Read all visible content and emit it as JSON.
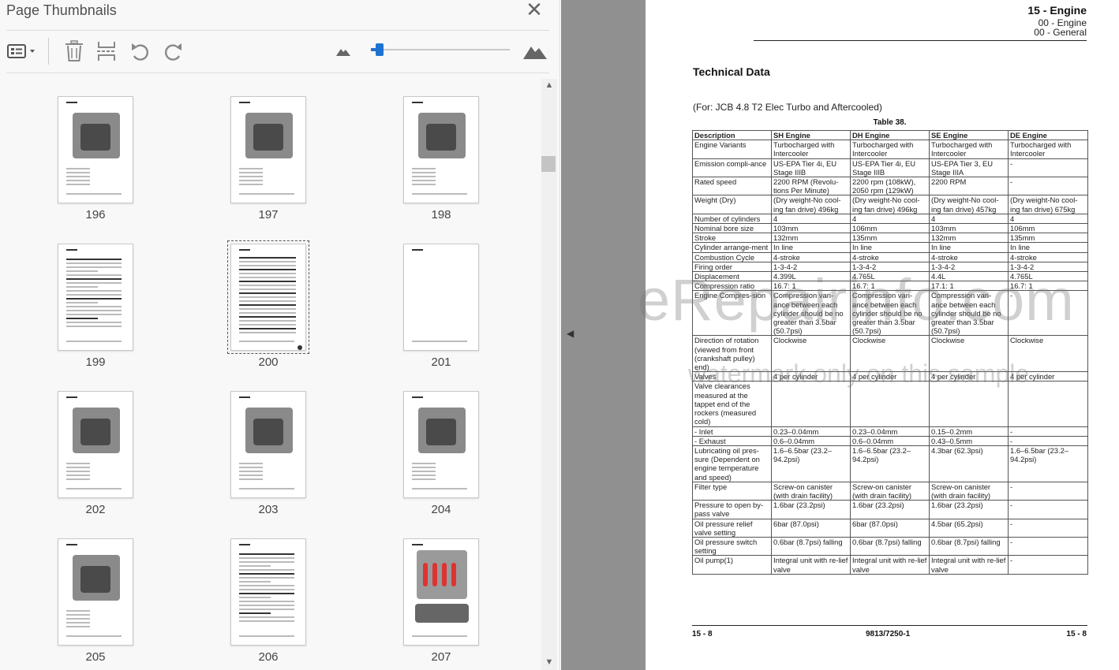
{
  "panel": {
    "title": "Page Thumbnails",
    "close_glyph": "✕",
    "toolbar": [
      {
        "name": "thumbnail-options-icon",
        "glyph": "☰ ▾"
      },
      {
        "name": "delete-pages-icon",
        "glyph": "🗑"
      },
      {
        "name": "extract-pages-icon",
        "glyph": "⎘"
      },
      {
        "name": "rotate-counterclockwise-icon",
        "glyph": "↺"
      },
      {
        "name": "rotate-clockwise-icon",
        "glyph": "↻"
      },
      {
        "name": "zoom-out-mountain-icon",
        "glyph": "▲"
      },
      {
        "name": "zoom-in-mountain-icon",
        "glyph": "▲"
      }
    ],
    "zoom_slider_fraction": 0.04,
    "scroll_up": "▲",
    "scroll_down": "▼",
    "thumbnails": [
      {
        "page": "196",
        "kind": "engine"
      },
      {
        "page": "197",
        "kind": "engine"
      },
      {
        "page": "198",
        "kind": "engine"
      },
      {
        "page": "199",
        "kind": "text"
      },
      {
        "page": "200",
        "kind": "table",
        "selected": true
      },
      {
        "page": "201",
        "kind": "blank"
      },
      {
        "page": "202",
        "kind": "engine"
      },
      {
        "page": "203",
        "kind": "engine"
      },
      {
        "page": "204",
        "kind": "engine"
      },
      {
        "page": "205",
        "kind": "engine"
      },
      {
        "page": "206",
        "kind": "text"
      },
      {
        "page": "207",
        "kind": "injectors"
      }
    ]
  },
  "divider": {
    "collapse_glyph": "◀"
  },
  "document": {
    "header_main": "15 - Engine",
    "header_sub1": "00 - Engine",
    "header_sub2": "00 - General",
    "title": "Technical Data",
    "subtitle": "(For: JCB 4.8 T2 Elec Turbo and Aftercooled)",
    "table_caption": "Table 38.",
    "table": {
      "headers": [
        "Description",
        "SH Engine",
        "DH Engine",
        "SE Engine",
        "DE Engine"
      ],
      "rows": [
        [
          "Engine Variants",
          "Turbocharged with Intercooler",
          "Turbocharged with Intercooler",
          "Turbocharged with Intercooler",
          "Turbocharged with Intercooler"
        ],
        [
          "Emission compli-ance",
          "US-EPA Tier 4i, EU Stage IIIB",
          "US-EPA Tier 4i, EU Stage IIIB",
          "US-EPA Tier 3, EU Stage IIIA",
          "-"
        ],
        [
          "Rated speed",
          "2200 RPM (Revolu-tions Per Minute)",
          "2200 rpm (108kW), 2050 rpm (129kW)",
          "2200 RPM",
          "-"
        ],
        [
          "Weight (Dry)",
          "(Dry weight-No cool-ing fan drive) 496kg",
          "(Dry weight-No cool-ing fan drive) 496kg",
          "(Dry weight-No cool-ing fan drive) 457kg",
          "(Dry weight-No cool-ing fan drive) 675kg"
        ],
        [
          "Number of cylinders",
          "4",
          "4",
          "4",
          "4"
        ],
        [
          "Nominal bore size",
          "103mm",
          "106mm",
          "103mm",
          "106mm"
        ],
        [
          "Stroke",
          "132mm",
          "135mm",
          "132mm",
          "135mm"
        ],
        [
          "Cylinder arrange-ment",
          "In line",
          "In line",
          "In line",
          "In line"
        ],
        [
          "Combustion Cycle",
          "4-stroke",
          "4-stroke",
          "4-stroke",
          "4-stroke"
        ],
        [
          "Firing order",
          "1-3-4-2",
          "1-3-4-2",
          "1-3-4-2",
          "1-3-4-2"
        ],
        [
          "Displacement",
          "4.399L",
          "4.765L",
          "4.4L",
          "4.765L"
        ],
        [
          "Compression ratio",
          "16.7: 1",
          "16.7: 1",
          "17.1: 1",
          "16.7: 1"
        ],
        [
          "Engine Compres-sion",
          "Compression vari-ance between each cylinder should be no greater than 3.5bar (50.7psi)",
          "Compression vari-ance between each cylinder should be no greater than 3.5bar (50.7psi)",
          "Compression vari-ance between each cylinder should be no greater than 3.5bar (50.7psi)",
          "-"
        ],
        [
          "Direction of rotation (viewed from front (crankshaft pulley) end)",
          "Clockwise",
          "Clockwise",
          "Clockwise",
          "Clockwise"
        ],
        [
          "Valves",
          "4 per cylinder",
          "4 per cylinder",
          "4 per cylinder",
          "4 per cylinder"
        ],
        [
          "Valve clearances measured at the tappet end of the rockers (measured cold)",
          "",
          "",
          "",
          ""
        ],
        [
          "- Inlet",
          "0.23–0.04mm",
          "0.23–0.04mm",
          "0.15–0.2mm",
          "-"
        ],
        [
          "- Exhaust",
          "0.6–0.04mm",
          "0.6–0.04mm",
          "0.43–0.5mm",
          "-"
        ],
        [
          "Lubricating oil pres-sure (Dependent on engine temperature and speed)",
          "1.6–6.5bar (23.2–94.2psi)",
          "1.6–6.5bar (23.2–94.2psi)",
          "4.3bar (62.3psi)",
          "1.6–6.5bar (23.2–94.2psi)"
        ],
        [
          "Filter type",
          "Screw-on canister (with drain facility)",
          "Screw-on canister (with drain facility)",
          "Screw-on canister (with drain facility)",
          "-"
        ],
        [
          "Pressure to open by-pass valve",
          "1.6bar (23.2psi)",
          "1.6bar (23.2psi)",
          "1.6bar (23.2psi)",
          "-"
        ],
        [
          "Oil pressure relief valve setting",
          "6bar (87.0psi)",
          "6bar (87.0psi)",
          "4.5bar (65.2psi)",
          "-"
        ],
        [
          "Oil pressure switch setting",
          "0.6bar (8.7psi) falling",
          "0.6bar (8.7psi) falling",
          "0.6bar (8.7psi) falling",
          "-"
        ],
        [
          "Oil pump(1)",
          "Integral unit with re-lief valve",
          "Integral unit with re-lief valve",
          "Integral unit with re-lief valve",
          "-"
        ]
      ]
    },
    "footer_left": "15 - 8",
    "footer_center": "9813/7250-1",
    "footer_right": "15 - 8",
    "watermark_main": "eRepairinfo.com",
    "watermark_sub": "watermark only on this sample"
  }
}
